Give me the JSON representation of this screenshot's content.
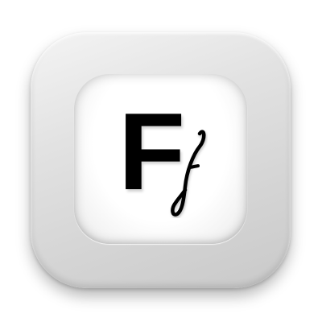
{
  "icon": {
    "name": "font-app-icon",
    "letter_upper": "F",
    "letter_lower": "f",
    "colors": {
      "frame": "#d9d9d9",
      "face": "#ffffff",
      "glyph": "#000000"
    }
  }
}
